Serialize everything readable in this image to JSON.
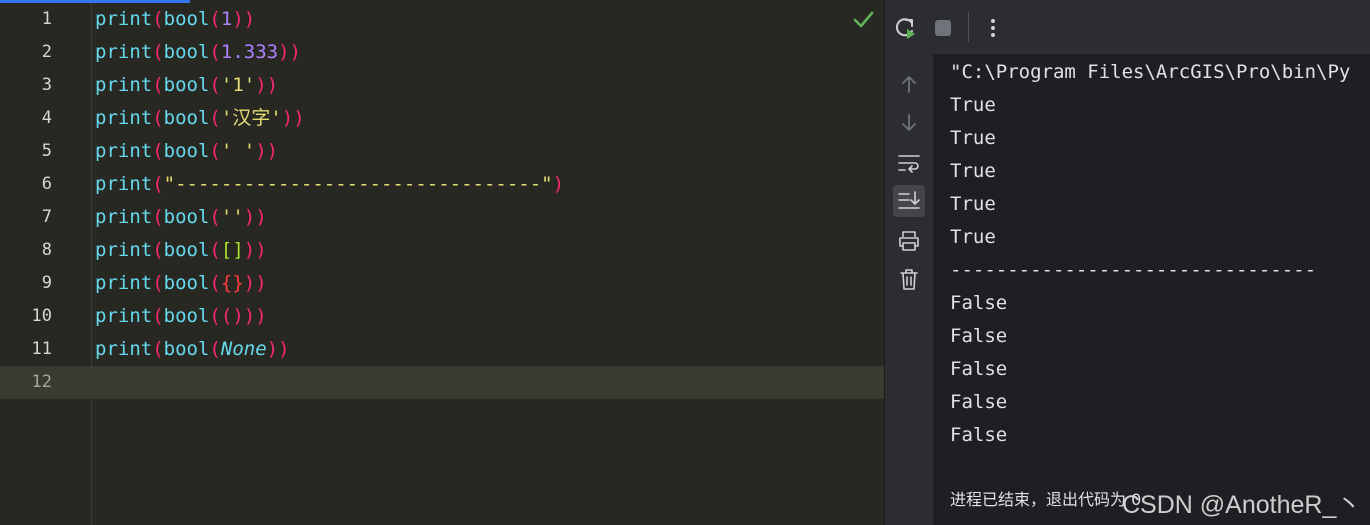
{
  "editor": {
    "lines": [
      {
        "number": "1"
      },
      {
        "number": "2"
      },
      {
        "number": "3"
      },
      {
        "number": "4"
      },
      {
        "number": "5"
      },
      {
        "number": "6"
      },
      {
        "number": "7"
      },
      {
        "number": "8"
      },
      {
        "number": "9"
      },
      {
        "number": "10"
      },
      {
        "number": "11"
      },
      {
        "number": "12"
      }
    ],
    "code": {
      "print": "print",
      "bool": "bool",
      "paren_open": "(",
      "paren_close": ")",
      "l1_arg": "1",
      "l2_arg": "1.333",
      "l3_arg": "'1'",
      "l4_arg": "'汉字'",
      "l5_arg": "' '",
      "l6_arg": "\"--------------------------------\"",
      "l7_arg": "''",
      "l8_arg": "[]",
      "l9_arg": "{}",
      "l10_arg": "()",
      "l11_arg": "None"
    },
    "inspection_icon": "check-icon",
    "colors": {
      "keyword": "#66d9ef",
      "paren": "#f92672",
      "number": "#ae81ff",
      "string": "#e6db74",
      "none": "#66d9ef"
    }
  },
  "run_panel": {
    "toolbar": {
      "rerun_icon": "rerun-icon",
      "stop_icon": "stop-icon",
      "more_icon": "more-vertical-icon"
    },
    "side": {
      "up_icon": "arrow-up-icon",
      "down_icon": "arrow-down-icon",
      "wrap_icon": "soft-wrap-icon",
      "scroll_icon": "scroll-to-end-icon",
      "print_icon": "print-icon",
      "clear_icon": "trash-icon"
    },
    "output": {
      "command": "\"C:\\Program Files\\ArcGIS\\Pro\\bin\\Py",
      "results": [
        "True",
        "True",
        "True",
        "True",
        "True",
        "--------------------------------",
        "False",
        "False",
        "False",
        "False",
        "False"
      ],
      "exit_message": "进程已结束，退出代码为 0"
    }
  },
  "watermark": "CSDN @AnotheR_丶"
}
